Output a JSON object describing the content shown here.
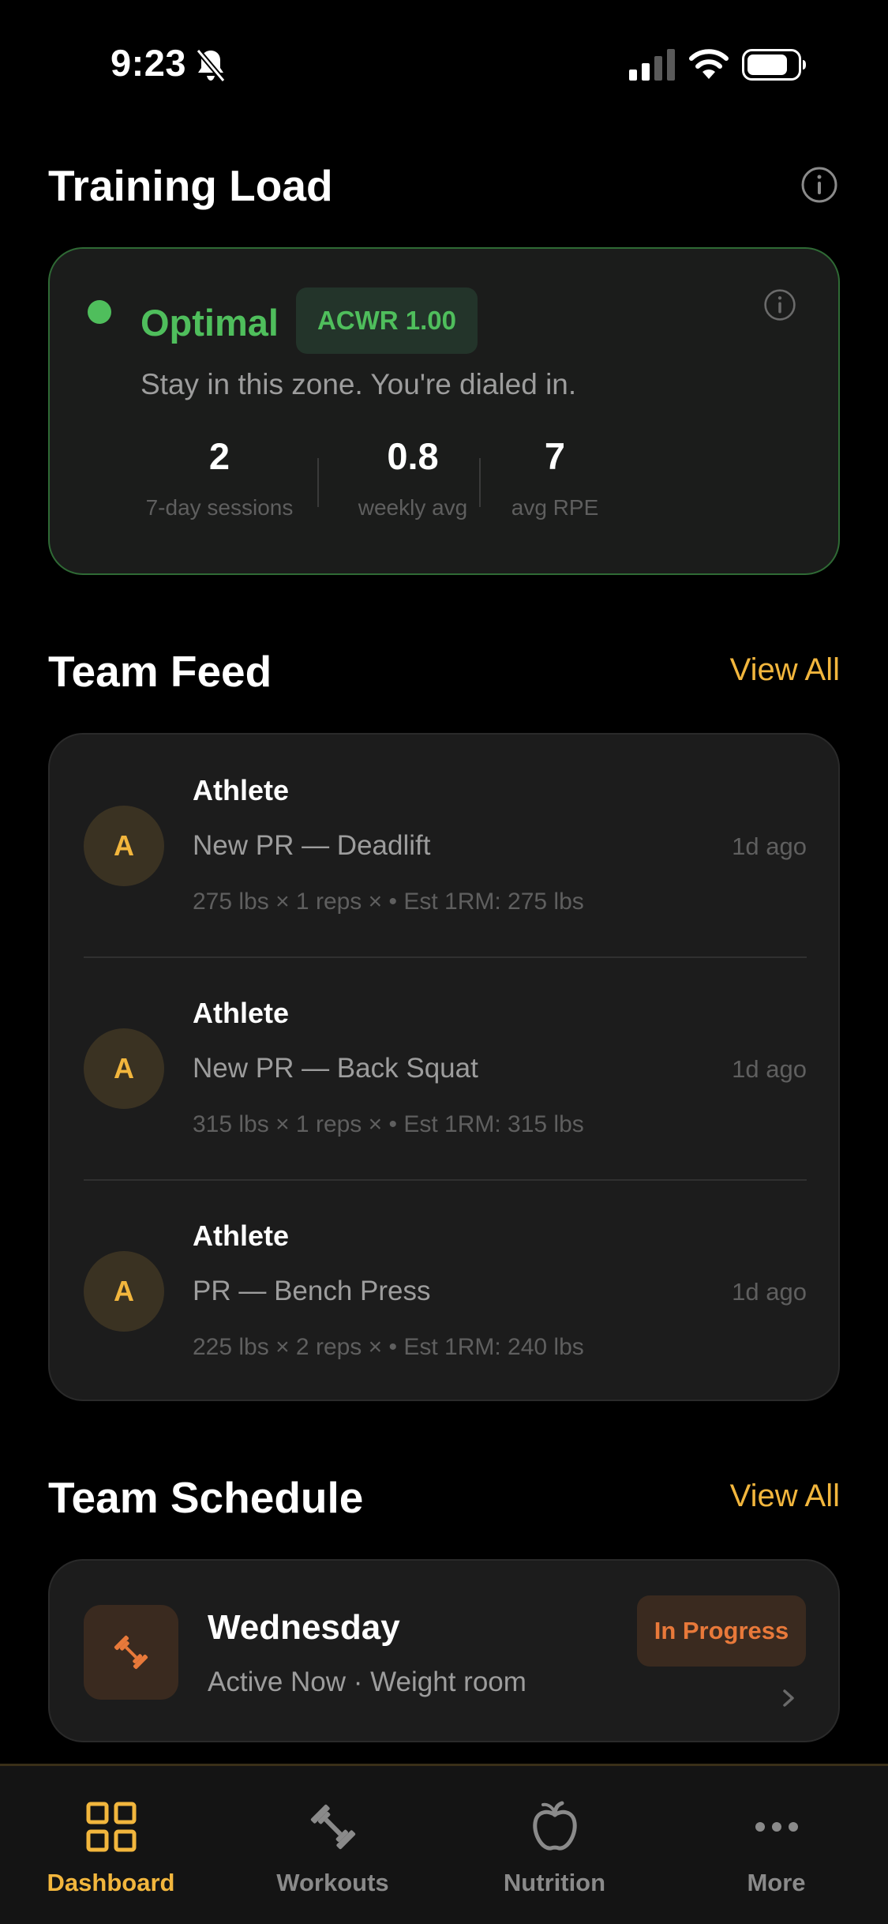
{
  "status_bar": {
    "time": "9:23"
  },
  "training_load": {
    "title": "Training Load",
    "status": "Optimal",
    "status_color": "#4fbe5c",
    "acwr_badge": "ACWR 1.00",
    "subtitle": "Stay in this zone. You're dialed in.",
    "stats": [
      {
        "value": "2",
        "label": "7-day sessions"
      },
      {
        "value": "0.8",
        "label": "weekly avg"
      },
      {
        "value": "7",
        "label": "avg RPE"
      }
    ]
  },
  "team_feed": {
    "title": "Team Feed",
    "view_all": "View All",
    "items": [
      {
        "avatar": "A",
        "name": "Athlete",
        "title": "New PR — Deadlift",
        "detail": "275 lbs × 1 reps × • Est 1RM: 275 lbs",
        "time": "1d ago"
      },
      {
        "avatar": "A",
        "name": "Athlete",
        "title": "New PR — Back Squat",
        "detail": "315 lbs × 1 reps × • Est 1RM: 315 lbs",
        "time": "1d ago"
      },
      {
        "avatar": "A",
        "name": "Athlete",
        "title": "PR — Bench Press",
        "detail": "225 lbs × 2 reps × • Est 1RM: 240 lbs",
        "time": "1d ago"
      }
    ]
  },
  "team_schedule": {
    "title": "Team Schedule",
    "view_all": "View All",
    "event": {
      "day": "Wednesday",
      "subtitle": "Active Now · Weight room",
      "badge": "In Progress",
      "icon": "dumbbell-icon"
    }
  },
  "tab_bar": {
    "tabs": [
      {
        "label": "Dashboard",
        "icon": "grid-icon",
        "active": true
      },
      {
        "label": "Workouts",
        "icon": "dumbbell-icon",
        "active": false
      },
      {
        "label": "Nutrition",
        "icon": "apple-icon",
        "active": false
      },
      {
        "label": "More",
        "icon": "more-icon",
        "active": false
      }
    ]
  },
  "colors": {
    "accent": "#f2b63d",
    "optimal_green": "#4fbe5c",
    "in_progress_orange": "#e8793a",
    "background": "#000000",
    "card": "#1c1c1c"
  }
}
